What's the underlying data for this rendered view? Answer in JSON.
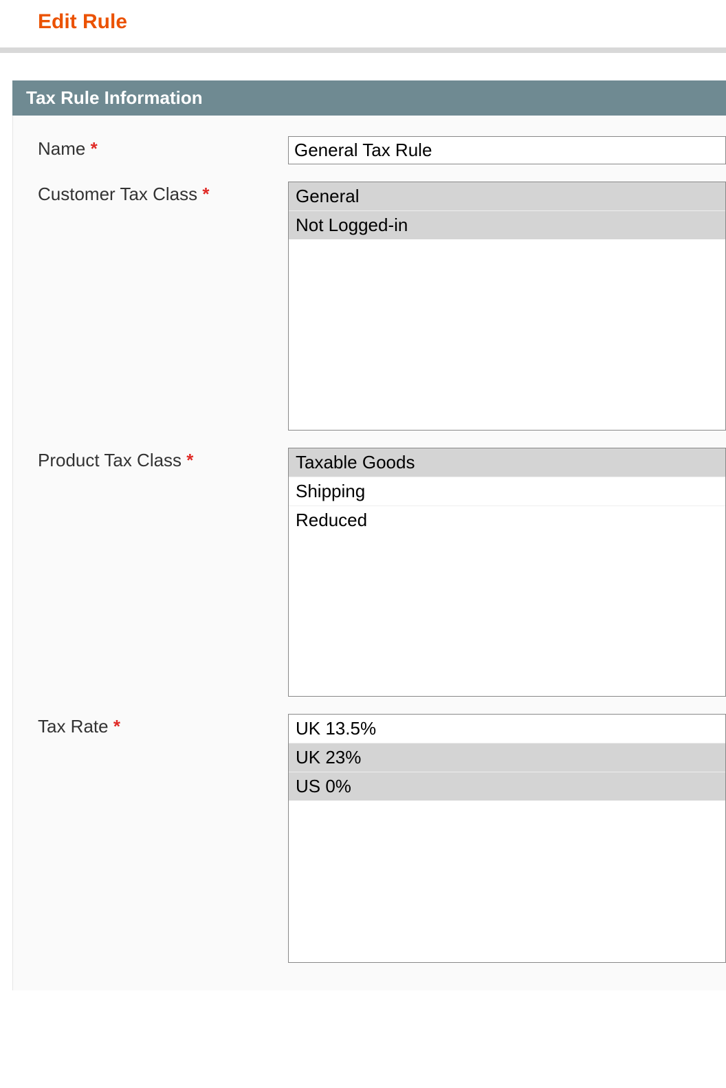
{
  "page": {
    "title": "Edit Rule"
  },
  "section": {
    "title": "Tax Rule Information"
  },
  "form": {
    "name": {
      "label": "Name",
      "required": "*",
      "value": "General Tax Rule"
    },
    "customer_tax_class": {
      "label": "Customer Tax Class",
      "required": "*",
      "options": [
        {
          "label": "General",
          "selected": true
        },
        {
          "label": "Not Logged-in",
          "selected": true
        }
      ]
    },
    "product_tax_class": {
      "label": "Product Tax Class",
      "required": "*",
      "options": [
        {
          "label": "Taxable Goods",
          "selected": true
        },
        {
          "label": "Shipping",
          "selected": false
        },
        {
          "label": "Reduced",
          "selected": false
        }
      ]
    },
    "tax_rate": {
      "label": "Tax Rate",
      "required": "*",
      "options": [
        {
          "label": "UK 13.5%",
          "selected": false
        },
        {
          "label": "UK 23%",
          "selected": true
        },
        {
          "label": "US 0%",
          "selected": true
        }
      ]
    }
  }
}
